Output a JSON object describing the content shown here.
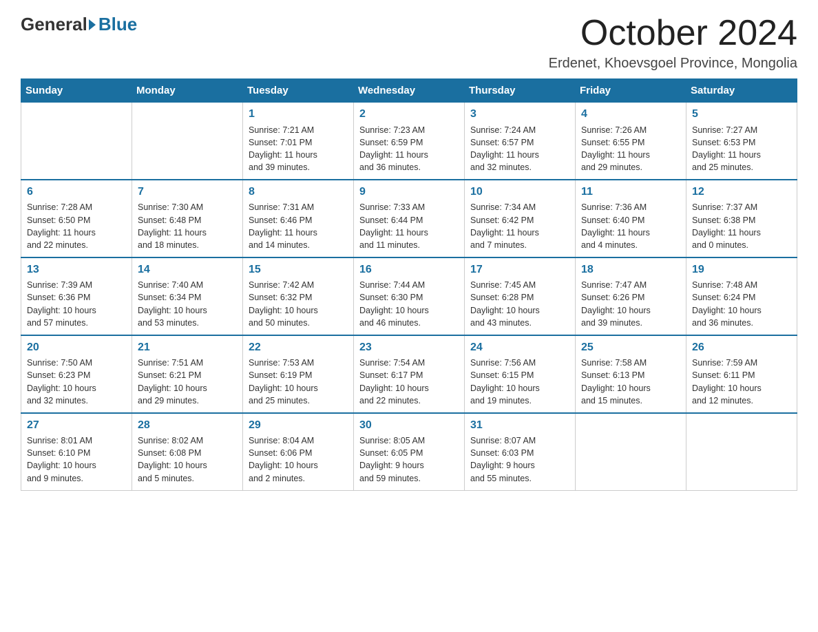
{
  "logo": {
    "general": "General",
    "blue": "Blue"
  },
  "title": "October 2024",
  "location": "Erdenet, Khoevsgoel Province, Mongolia",
  "weekdays": [
    "Sunday",
    "Monday",
    "Tuesday",
    "Wednesday",
    "Thursday",
    "Friday",
    "Saturday"
  ],
  "weeks": [
    [
      {
        "day": "",
        "info": ""
      },
      {
        "day": "",
        "info": ""
      },
      {
        "day": "1",
        "info": "Sunrise: 7:21 AM\nSunset: 7:01 PM\nDaylight: 11 hours\nand 39 minutes."
      },
      {
        "day": "2",
        "info": "Sunrise: 7:23 AM\nSunset: 6:59 PM\nDaylight: 11 hours\nand 36 minutes."
      },
      {
        "day": "3",
        "info": "Sunrise: 7:24 AM\nSunset: 6:57 PM\nDaylight: 11 hours\nand 32 minutes."
      },
      {
        "day": "4",
        "info": "Sunrise: 7:26 AM\nSunset: 6:55 PM\nDaylight: 11 hours\nand 29 minutes."
      },
      {
        "day": "5",
        "info": "Sunrise: 7:27 AM\nSunset: 6:53 PM\nDaylight: 11 hours\nand 25 minutes."
      }
    ],
    [
      {
        "day": "6",
        "info": "Sunrise: 7:28 AM\nSunset: 6:50 PM\nDaylight: 11 hours\nand 22 minutes."
      },
      {
        "day": "7",
        "info": "Sunrise: 7:30 AM\nSunset: 6:48 PM\nDaylight: 11 hours\nand 18 minutes."
      },
      {
        "day": "8",
        "info": "Sunrise: 7:31 AM\nSunset: 6:46 PM\nDaylight: 11 hours\nand 14 minutes."
      },
      {
        "day": "9",
        "info": "Sunrise: 7:33 AM\nSunset: 6:44 PM\nDaylight: 11 hours\nand 11 minutes."
      },
      {
        "day": "10",
        "info": "Sunrise: 7:34 AM\nSunset: 6:42 PM\nDaylight: 11 hours\nand 7 minutes."
      },
      {
        "day": "11",
        "info": "Sunrise: 7:36 AM\nSunset: 6:40 PM\nDaylight: 11 hours\nand 4 minutes."
      },
      {
        "day": "12",
        "info": "Sunrise: 7:37 AM\nSunset: 6:38 PM\nDaylight: 11 hours\nand 0 minutes."
      }
    ],
    [
      {
        "day": "13",
        "info": "Sunrise: 7:39 AM\nSunset: 6:36 PM\nDaylight: 10 hours\nand 57 minutes."
      },
      {
        "day": "14",
        "info": "Sunrise: 7:40 AM\nSunset: 6:34 PM\nDaylight: 10 hours\nand 53 minutes."
      },
      {
        "day": "15",
        "info": "Sunrise: 7:42 AM\nSunset: 6:32 PM\nDaylight: 10 hours\nand 50 minutes."
      },
      {
        "day": "16",
        "info": "Sunrise: 7:44 AM\nSunset: 6:30 PM\nDaylight: 10 hours\nand 46 minutes."
      },
      {
        "day": "17",
        "info": "Sunrise: 7:45 AM\nSunset: 6:28 PM\nDaylight: 10 hours\nand 43 minutes."
      },
      {
        "day": "18",
        "info": "Sunrise: 7:47 AM\nSunset: 6:26 PM\nDaylight: 10 hours\nand 39 minutes."
      },
      {
        "day": "19",
        "info": "Sunrise: 7:48 AM\nSunset: 6:24 PM\nDaylight: 10 hours\nand 36 minutes."
      }
    ],
    [
      {
        "day": "20",
        "info": "Sunrise: 7:50 AM\nSunset: 6:23 PM\nDaylight: 10 hours\nand 32 minutes."
      },
      {
        "day": "21",
        "info": "Sunrise: 7:51 AM\nSunset: 6:21 PM\nDaylight: 10 hours\nand 29 minutes."
      },
      {
        "day": "22",
        "info": "Sunrise: 7:53 AM\nSunset: 6:19 PM\nDaylight: 10 hours\nand 25 minutes."
      },
      {
        "day": "23",
        "info": "Sunrise: 7:54 AM\nSunset: 6:17 PM\nDaylight: 10 hours\nand 22 minutes."
      },
      {
        "day": "24",
        "info": "Sunrise: 7:56 AM\nSunset: 6:15 PM\nDaylight: 10 hours\nand 19 minutes."
      },
      {
        "day": "25",
        "info": "Sunrise: 7:58 AM\nSunset: 6:13 PM\nDaylight: 10 hours\nand 15 minutes."
      },
      {
        "day": "26",
        "info": "Sunrise: 7:59 AM\nSunset: 6:11 PM\nDaylight: 10 hours\nand 12 minutes."
      }
    ],
    [
      {
        "day": "27",
        "info": "Sunrise: 8:01 AM\nSunset: 6:10 PM\nDaylight: 10 hours\nand 9 minutes."
      },
      {
        "day": "28",
        "info": "Sunrise: 8:02 AM\nSunset: 6:08 PM\nDaylight: 10 hours\nand 5 minutes."
      },
      {
        "day": "29",
        "info": "Sunrise: 8:04 AM\nSunset: 6:06 PM\nDaylight: 10 hours\nand 2 minutes."
      },
      {
        "day": "30",
        "info": "Sunrise: 8:05 AM\nSunset: 6:05 PM\nDaylight: 9 hours\nand 59 minutes."
      },
      {
        "day": "31",
        "info": "Sunrise: 8:07 AM\nSunset: 6:03 PM\nDaylight: 9 hours\nand 55 minutes."
      },
      {
        "day": "",
        "info": ""
      },
      {
        "day": "",
        "info": ""
      }
    ]
  ]
}
